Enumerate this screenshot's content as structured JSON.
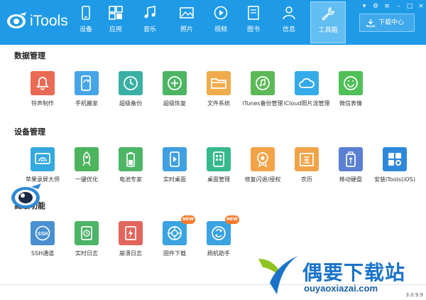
{
  "app": {
    "title": "iTools",
    "version": "3.0.9.9"
  },
  "nav": [
    {
      "label": "设备",
      "icon": "phone-icon"
    },
    {
      "label": "应用",
      "icon": "apps-icon"
    },
    {
      "label": "音乐",
      "icon": "music-icon"
    },
    {
      "label": "照片",
      "icon": "photo-icon"
    },
    {
      "label": "视频",
      "icon": "video-icon"
    },
    {
      "label": "图书",
      "icon": "book-icon"
    },
    {
      "label": "信息",
      "icon": "person-icon"
    },
    {
      "label": "工具箱",
      "icon": "wrench-icon",
      "active": true
    }
  ],
  "download_center": "下载中心",
  "sections": [
    {
      "title": "数据管理",
      "items": [
        {
          "label": "铃声制作",
          "icon": "bell-icon",
          "color": "#ea6a55"
        },
        {
          "label": "手机搬家",
          "icon": "phone-transfer-icon",
          "color": "#46a5e6"
        },
        {
          "label": "超级备份",
          "icon": "backup-clock-icon",
          "color": "#3ab0a5"
        },
        {
          "label": "超级恢复",
          "icon": "restore-icon",
          "color": "#4cb463"
        },
        {
          "label": "文件系统",
          "icon": "folder-icon",
          "color": "#f0ac4c"
        },
        {
          "label": "iTunes备份管理",
          "icon": "itunes-icon",
          "color": "#5cb956"
        },
        {
          "label": "iCloud照片流管理",
          "icon": "cloud-icon",
          "color": "#35aae8"
        },
        {
          "label": "微信表情",
          "icon": "smile-icon",
          "color": "#4fbf57"
        }
      ]
    },
    {
      "title": "设备管理",
      "items": [
        {
          "label": "苹果录屏大师",
          "icon": "screen-cast-icon",
          "color": "#34a8df"
        },
        {
          "label": "一键优化",
          "icon": "rocket-icon",
          "color": "#4db45e"
        },
        {
          "label": "电池专家",
          "icon": "battery-icon",
          "color": "#4cb566"
        },
        {
          "label": "实时桌面",
          "icon": "live-desktop-icon",
          "color": "#3f9fe0"
        },
        {
          "label": "桌面管理",
          "icon": "grid-icon",
          "color": "#37b98f"
        },
        {
          "label": "修复闪退/授权",
          "icon": "badge-icon",
          "color": "#f3a348"
        },
        {
          "label": "农历",
          "icon": "calendar-icon",
          "color": "#f1a34a"
        },
        {
          "label": "移动硬盘",
          "icon": "usb-drive-icon",
          "color": "#5b7fd2"
        },
        {
          "label": "安装iTools(iOS)",
          "icon": "install-itools-icon",
          "color": "#2f88dc"
        }
      ]
    },
    {
      "title": "高级功能",
      "items": [
        {
          "label": "SSH通道",
          "icon": "ssh-icon",
          "color": "#4a90d0"
        },
        {
          "label": "实时日志",
          "icon": "log-icon",
          "color": "#4cb466"
        },
        {
          "label": "崩溃日志",
          "icon": "crash-log-icon",
          "color": "#e2665d"
        },
        {
          "label": "固件下载",
          "icon": "firmware-icon",
          "color": "#3aa3e2",
          "badge": "NEW"
        },
        {
          "label": "刷机助手",
          "icon": "flash-icon",
          "color": "#3aa3e2",
          "badge": "NEW"
        }
      ]
    }
  ],
  "watermark": {
    "cn": "偶要下载站",
    "en": "ouyaoxiazai.com"
  }
}
